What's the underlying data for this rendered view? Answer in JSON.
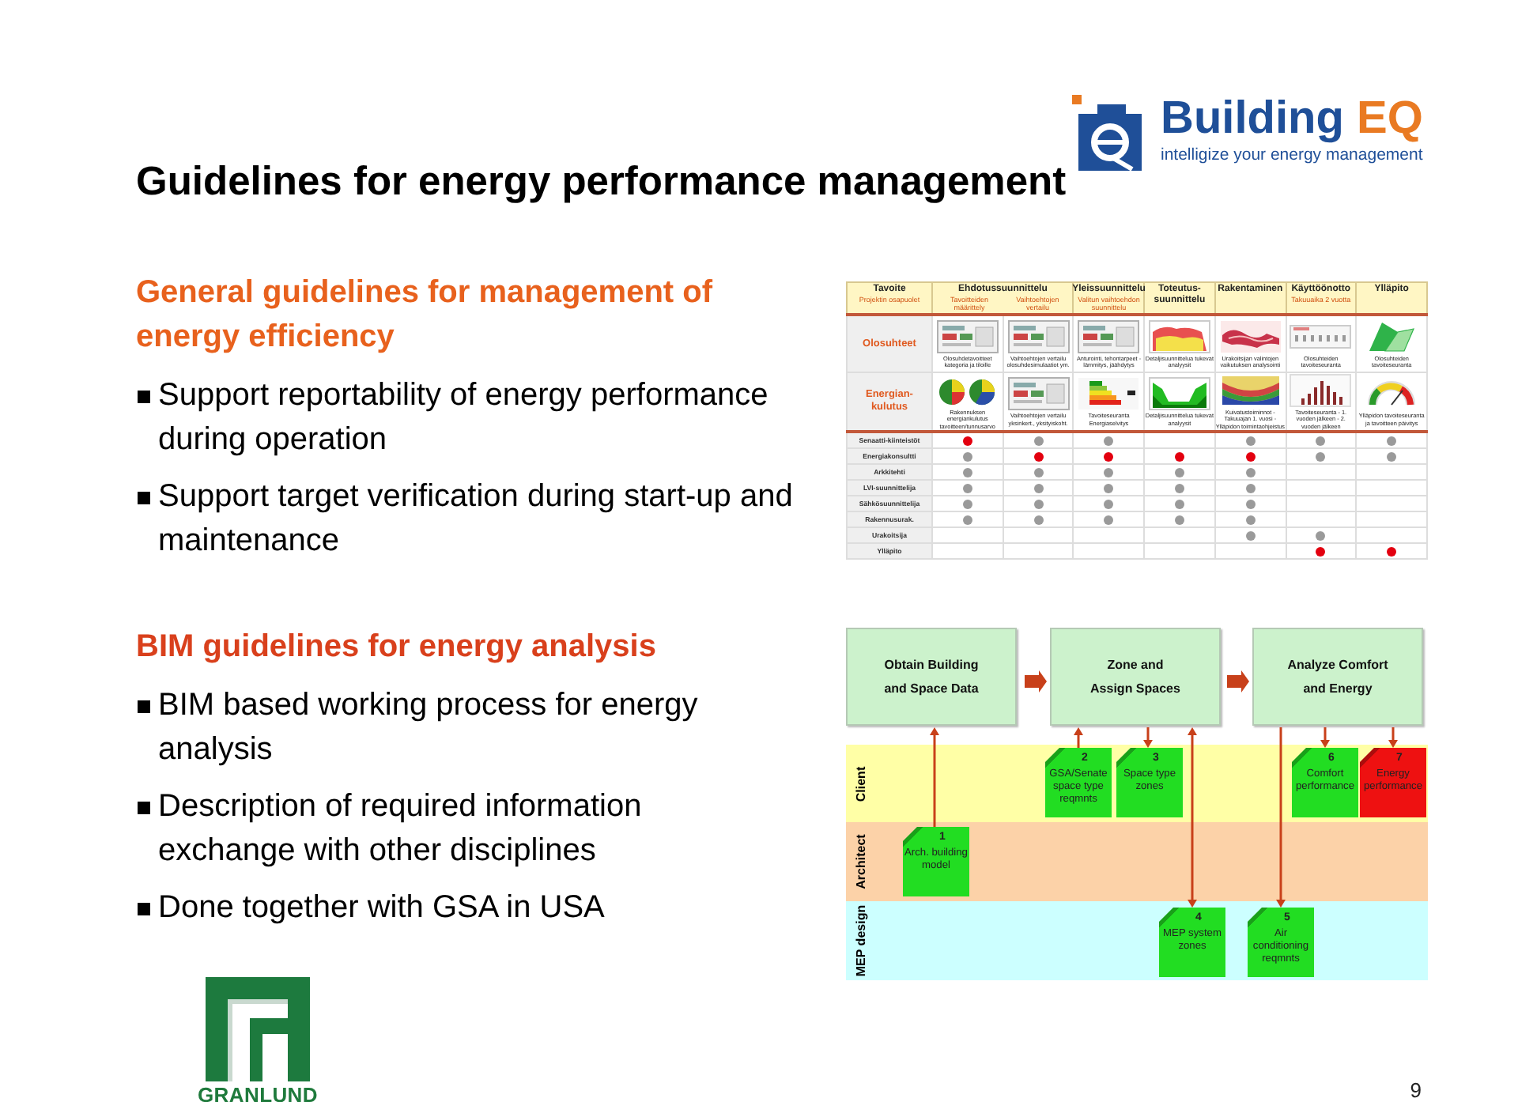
{
  "logo": {
    "name": "Building",
    "accent": "EQ",
    "tagline": "intelligize your energy management"
  },
  "title": "Guidelines for energy performance management",
  "sections": [
    {
      "heading": "General guidelines for management of energy efficiency",
      "bullets": [
        "Support reportability of energy performance during operation",
        "Support target verification during start-up and maintenance"
      ]
    },
    {
      "heading": "BIM guidelines for energy analysis",
      "bullets": [
        "BIM based working process for energy analysis",
        "Description of required information exchange with other disciplines",
        "Done together with GSA in USA"
      ]
    }
  ],
  "phase_table": {
    "corner_title": "Tavoite",
    "corner_subtitle": "Projektin osapuolet",
    "phases": [
      {
        "title": "Ehdotussuunnittelu",
        "subphases": [
          "Tavoitteiden määrittely",
          "Vaihtoehtojen vertailu"
        ]
      },
      {
        "title": "Yleissuunnittelu",
        "note": "Valitun vaihtoehdon suunnittelu"
      },
      {
        "title": "Toteutus-suunnittelu"
      },
      {
        "title": "Rakentaminen"
      },
      {
        "title": "Käyttöönotto",
        "note": "Takuuaika 2 vuotta"
      },
      {
        "title": "Ylläpito"
      }
    ],
    "goal_rows": [
      {
        "label": "Olosuhteet",
        "cells": [
          {
            "kind": "screen",
            "caption": "Olosuhdetavoitteet kategoria ja tiloille"
          },
          {
            "kind": "screen",
            "caption": "Vaihtoehtojen vertailu olosuhdesimulaatiot ym."
          },
          {
            "kind": "screen",
            "caption": "Anturointi, tehontarpeet - lämmitys, jäähdytys"
          },
          {
            "kind": "area",
            "caption": "Detaljisuunnittelua tukevat analyysit"
          },
          {
            "kind": "band",
            "caption": "Urakoitsijan valintojen vaikutuksen analysointi"
          },
          {
            "kind": "strip",
            "caption": "Olosuhteiden tavoiteseuranta"
          },
          {
            "kind": "leaves",
            "caption": "Olosuhteiden tavoiteseuranta"
          }
        ]
      },
      {
        "label": "Energian-kulutus",
        "cells": [
          {
            "kind": "pies",
            "caption": "Rakennuksen energiankulutus tavoitteen/tunnusarvo"
          },
          {
            "kind": "screen",
            "caption": "Vaihtoehtojen vertailu yksinkert., yksityiskoht."
          },
          {
            "kind": "label",
            "caption": "Tavoiteseuranta Energiaselvitys"
          },
          {
            "kind": "valley",
            "caption": "Detaljisuunnittelua tukevat analyysit"
          },
          {
            "kind": "stripes",
            "caption": "Kuivatustoiminnot - Takuuajan 1. vuosi - Ylläpidon toimintaohjeistus"
          },
          {
            "kind": "histogram",
            "caption": "Tavoiteseuranta - 1. vuoden jälkeen - 2. vuoden jälkeen"
          },
          {
            "kind": "gauge",
            "caption": "Ylläpidon tavoiteseuranta ja tavoitteen päivitys"
          }
        ]
      }
    ],
    "party_rows": [
      {
        "label": "Senaatti-kiinteistöt",
        "cells": [
          {
            "color": "#e3000f"
          },
          {
            "color": "#9a9a9a"
          },
          {
            "color": "#9a9a9a"
          },
          null,
          {
            "color": "#9a9a9a"
          },
          {
            "color": "#9a9a9a"
          },
          {
            "color": "#9a9a9a"
          }
        ]
      },
      {
        "label": "Energiakonsultti",
        "cells": [
          {
            "color": "#9a9a9a"
          },
          {
            "color": "#e3000f"
          },
          {
            "color": "#e3000f"
          },
          {
            "color": "#e3000f"
          },
          {
            "color": "#e3000f"
          },
          {
            "color": "#9a9a9a"
          },
          {
            "color": "#9a9a9a"
          }
        ]
      },
      {
        "label": "Arkkitehti",
        "cells": [
          {
            "color": "#9a9a9a"
          },
          {
            "color": "#9a9a9a"
          },
          {
            "color": "#9a9a9a"
          },
          {
            "color": "#9a9a9a"
          },
          {
            "color": "#9a9a9a"
          },
          null,
          null
        ]
      },
      {
        "label": "LVI-suunnittelija",
        "cells": [
          {
            "color": "#9a9a9a"
          },
          {
            "color": "#9a9a9a"
          },
          {
            "color": "#9a9a9a"
          },
          {
            "color": "#9a9a9a"
          },
          {
            "color": "#9a9a9a"
          },
          null,
          null
        ]
      },
      {
        "label": "Sähkösuunnittelija",
        "cells": [
          {
            "color": "#9a9a9a"
          },
          {
            "color": "#9a9a9a"
          },
          {
            "color": "#9a9a9a"
          },
          {
            "color": "#9a9a9a"
          },
          {
            "color": "#9a9a9a"
          },
          null,
          null
        ]
      },
      {
        "label": "Rakennusurak.",
        "cells": [
          {
            "color": "#9a9a9a"
          },
          {
            "color": "#9a9a9a"
          },
          {
            "color": "#9a9a9a"
          },
          {
            "color": "#9a9a9a"
          },
          {
            "color": "#9a9a9a"
          },
          null,
          null
        ]
      },
      {
        "label": "Urakoitsija",
        "cells": [
          null,
          null,
          null,
          null,
          {
            "color": "#9a9a9a"
          },
          {
            "color": "#9a9a9a"
          },
          null
        ]
      },
      {
        "label": "Ylläpito",
        "cells": [
          null,
          null,
          null,
          null,
          null,
          {
            "color": "#e3000f"
          },
          {
            "color": "#e3000f"
          }
        ]
      }
    ]
  },
  "process": {
    "steps": [
      "Obtain Building\nand Space Data",
      "Zone and\nAssign Spaces",
      "Analyze Comfort\nand Energy"
    ],
    "lanes": [
      "Client",
      "Architect",
      "MEP design"
    ],
    "documents": [
      {
        "number": "1",
        "text": "Arch. building model",
        "color": "#22dd22"
      },
      {
        "number": "2",
        "text": "GSA/Senate space type reqmnts",
        "color": "#22dd22"
      },
      {
        "number": "3",
        "text": "Space type zones",
        "color": "#22dd22"
      },
      {
        "number": "4",
        "text": "MEP system zones",
        "color": "#22dd22"
      },
      {
        "number": "5",
        "text": "Air conditioning reqmnts",
        "color": "#22dd22"
      },
      {
        "number": "6",
        "text": "Comfort performance",
        "color": "#22dd22"
      },
      {
        "number": "7",
        "text": "Energy performance",
        "color": "#ee1111"
      }
    ]
  },
  "footer": {
    "brand": "GRANLUND",
    "page_number": "9"
  }
}
